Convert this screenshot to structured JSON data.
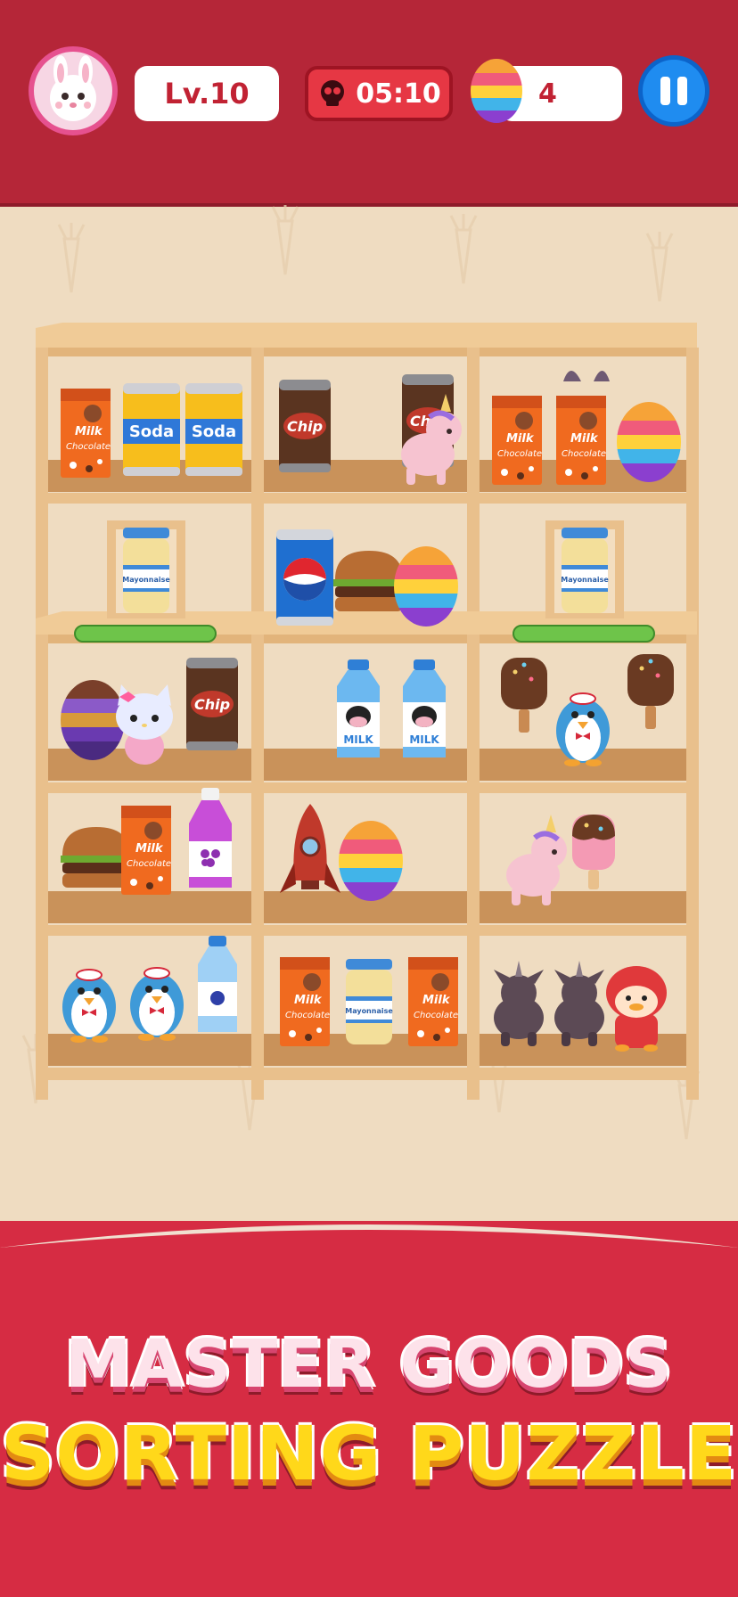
{
  "hud": {
    "level": "Lv.10",
    "timer": "05:10",
    "eggs": "4",
    "pause_label": "pause"
  },
  "banner": {
    "line1": "MASTER GOODS",
    "line2": "SORTING PUZZLE"
  },
  "labels": {
    "soda": "Soda",
    "chip": "Chip",
    "milk_choco_1": "Milk",
    "milk_choco_2": "Chocolate",
    "mayo": "Mayonnaise",
    "milk": "MILK"
  },
  "colors": {
    "header": "#b52638",
    "accent": "#e63744",
    "pause": "#1f8cf0",
    "shelf": "#e9c08c",
    "banner": "#d62c43"
  }
}
